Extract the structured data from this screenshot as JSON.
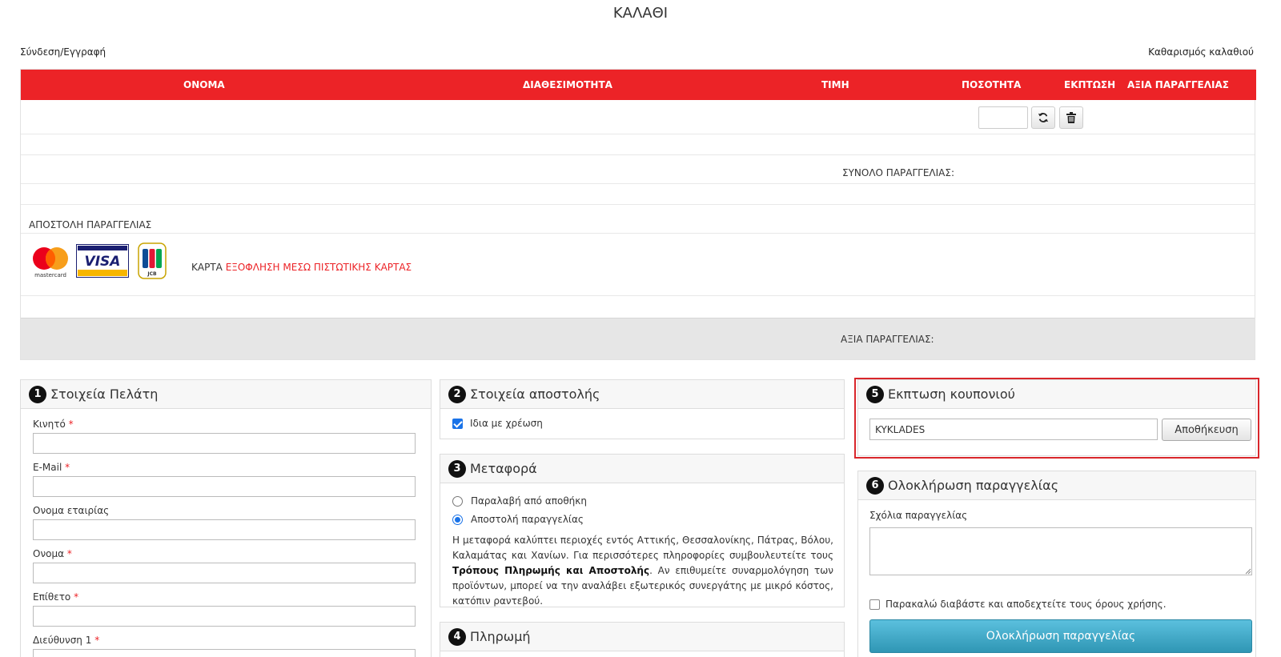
{
  "page": {
    "title": "ΚΑΛΑΘΙ"
  },
  "top_links": {
    "login": "Σύνδεση/Εγγραφή",
    "clear_cart": "Καθαρισμός καλαθιού"
  },
  "cart": {
    "columns": [
      "ΟΝΟΜΑ",
      "ΔΙΑΘΕΣΙΜΟΤΗΤΑ",
      "ΤΙΜΗ",
      "ΠΟΣΟΤΗΤΑ",
      "ΕΚΠΤΩΣΗ",
      "ΑΞΙΑ ΠΑΡΑΓΓΕΛΙΑΣ"
    ],
    "quantity_value": "",
    "order_total_label": "ΣΥΝΟΛΟ ΠΑΡΑΓΓΕΛΙΑΣ:",
    "shipping_label": "ΑΠΟΣΤΟΛΗ ΠΑΡΑΓΓΕΛΙΑΣ",
    "card_prefix": "ΚΑΡΤΑ",
    "card_payment_text": "ΕΞΟΦΛΗΣΗ ΜΕΣΩ ΠΙΣΤΩΤΙΚΗΣ ΚΑΡΤΑΣ",
    "card_logos": {
      "mastercard": "mastercard",
      "visa": "VISA",
      "jcb": "JCB"
    },
    "order_value_label": "ΑΞΙΑ ΠΑΡΑΓΓΕΛΙΑΣ:"
  },
  "customer": {
    "number": "1",
    "title": "Στοιχεία Πελάτη",
    "fields": [
      {
        "label": "Κινητό",
        "required": "*",
        "value": ""
      },
      {
        "label": "E-Mail",
        "required": "*",
        "value": ""
      },
      {
        "label": "Ονομα εταιρίας",
        "required": "",
        "value": ""
      },
      {
        "label": "Ονομα",
        "required": "*",
        "value": ""
      },
      {
        "label": "Επίθετο",
        "required": "*",
        "value": ""
      },
      {
        "label": "Διεύθυνση 1",
        "required": "*",
        "value": ""
      }
    ]
  },
  "shipping_info": {
    "number": "2",
    "title": "Στοιχεία αποστολής",
    "same_as_billing": "Ιδια με χρέωση",
    "same_checked": true
  },
  "transport": {
    "number": "3",
    "title": "Μεταφορά",
    "options": [
      "Παραλαβή από αποθήκη",
      "Αποστολή παραγγελίας"
    ],
    "selected": 1,
    "desc_part1": "Η μεταφορά καλύπτει περιοχές εντός Αττικής, Θεσσαλονίκης, Πάτρας, Βόλου, Καλαμάτας και Χανίων. Για περισσότερες πληροφορίες συμβουλευτείτε τους ",
    "desc_bold": "Τρόπους Πληρωμής και Αποστολής",
    "desc_part2": ". Αν επιθυμείτε συναρμολόγηση των προϊόντων, μπορεί να την αναλάβει εξωτερικός συνεργάτης με μικρό κόστος, κατόπιν ραντεβού."
  },
  "payment": {
    "number": "4",
    "title": "Πληρωμή"
  },
  "coupon": {
    "number": "5",
    "title": "Εκπτωση κουπονιού",
    "value": "KYKLADES",
    "save_label": "Αποθήκευση"
  },
  "complete": {
    "number": "6",
    "title": "Ολοκλήρωση παραγγελίας",
    "comments_label": "Σχόλια παραγγελίας",
    "comments_value": "",
    "terms_label": "Παρακαλώ διαβάστε και αποδεχτείτε τους όρους χρήσης.",
    "terms_checked": false,
    "button_label": "Ολοκλήρωση παραγγελίας"
  },
  "colors": {
    "header_red": "#ec2327",
    "complete_button": "#3ca6c8",
    "coupon_border": "#d9262b",
    "check_blue": "#1a73e8"
  }
}
